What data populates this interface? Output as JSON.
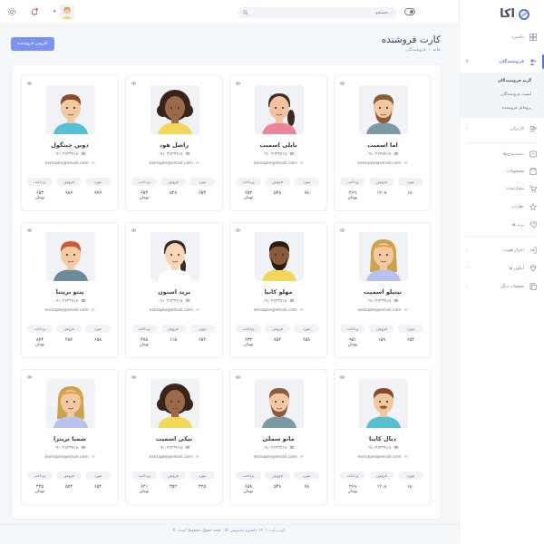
{
  "brand": {
    "name": "اکا",
    "accent": "#6b82e0"
  },
  "search": {
    "placeholder": "جستجو..."
  },
  "topbar": {
    "icons": [
      "toggle-icon",
      "bell-icon",
      "settings-icon"
    ]
  },
  "sidebar": {
    "items": [
      {
        "label": "داشبرد",
        "icon": "grid-icon",
        "arrow": ""
      },
      {
        "label": "فروشندگان",
        "icon": "sellers-icon",
        "arrow": "▾"
      },
      {
        "label": "کاربران",
        "icon": "users-icon",
        "arrow": "‹"
      },
      {
        "label": "دسته‌بندی‌ها",
        "icon": "tag-icon",
        "arrow": ""
      },
      {
        "label": "محصولات",
        "icon": "box-icon",
        "arrow": ""
      },
      {
        "label": "سفارشات",
        "icon": "cart-icon",
        "arrow": ""
      },
      {
        "label": "نظرات",
        "icon": "comment-icon",
        "arrow": ""
      },
      {
        "label": "برند ها",
        "icon": "brand-icon",
        "arrow": ""
      },
      {
        "label": "احراز هویت",
        "icon": "login-icon",
        "arrow": "‹"
      },
      {
        "label": "آیکون ها",
        "icon": "diamond-icon",
        "arrow": "‹"
      },
      {
        "label": "صفحات دیگر",
        "icon": "pages-icon",
        "arrow": "‹"
      }
    ],
    "submenu": [
      "گرید فروشندگان",
      "لیست فروشندگان",
      "پروفایل فروشنده"
    ]
  },
  "page": {
    "title": "کارت فروشنده",
    "breadcrumb_home": "خانه",
    "breadcrumb_sep": "›",
    "breadcrumb_current": "فروشندگان",
    "add_button": "افزودن فروشنده"
  },
  "stat_labels": {
    "items": "مورد",
    "sales": "فروش",
    "payment": "پرداخت",
    "unit": "تومان"
  },
  "sellers": [
    {
      "name": "اما اسمیت",
      "phone": "۰۹۱۰۳۶۳۸۷۱۸",
      "email": "exmaple@email.com",
      "items": "۱۸۰",
      "sales": "۱۲۰۸",
      "payment": "۲۶۹",
      "skin": "#f0c9a0",
      "hair": "#8a5a3a",
      "shirt": "#7c9aa6",
      "beard": true,
      "hairStyle": "short"
    },
    {
      "name": "بایلی اسمیت",
      "phone": "۰۹۱۰۳۶۳۳۷۱۸",
      "email": "exmaple@email.com",
      "items": "۶۵",
      "sales": "۵۴۸",
      "payment": "۶۵۳",
      "skin": "#f2c29e",
      "hair": "#3d2a22",
      "shirt": "#e9879a",
      "beard": false,
      "hairStyle": "pony"
    },
    {
      "name": "راشل هود",
      "phone": "۰۹۱۰۳۶۳۳۷۱۸",
      "email": "exmaple@email.com",
      "items": "۶۵۳",
      "sales": "۵۴۸",
      "payment": "۶۵۳",
      "skin": "#9a6a4a",
      "hair": "#3a241a",
      "shirt": "#f3d75a",
      "beard": false,
      "hairStyle": "curly"
    },
    {
      "name": "دوبن چیتگول",
      "phone": "۰۹۱۰۳۶۳۳۷۱۸",
      "email": "exmaple@email.com",
      "items": "۹۷۷",
      "sales": "۹۸۷",
      "payment": "۶۵۳",
      "skin": "#f0c9a0",
      "hair": "#8a4a2a",
      "shirt": "#56c0d0",
      "beard": false,
      "hairStyle": "short"
    },
    {
      "name": "نیتیلو اسمیت",
      "phone": "۰۹۱۰۳۶۳۳۷۱۸",
      "email": "exmaple@email.com",
      "items": "۶۵۴",
      "sales": "۱۵۹",
      "payment": "۹۵۱",
      "skin": "#f2c9a2",
      "hair": "#caa34a",
      "shirt": "#b8c2f0",
      "beard": false,
      "hairStyle": "long"
    },
    {
      "name": "مهلو کانیا",
      "phone": "۰۹۱۰۳۶۳۳۷۱۸",
      "email": "exmaple@email.com",
      "items": "۶۵۸",
      "sales": "۸۵۴",
      "payment": "۶۳۳",
      "skin": "#8a5a3a",
      "hair": "#2a1a12",
      "shirt": "#f3d75a",
      "beard": true,
      "hairStyle": "short"
    },
    {
      "name": "برید استون",
      "phone": "۰۹۱۰۳۶۳۳۷۱۸",
      "email": "exmaple@email.com",
      "items": "۶۵۲",
      "sales": "۱۱۵",
      "payment": "۴۷۵",
      "skin": "#f6d6b6",
      "hair": "#3a2a22",
      "shirt": "#ffffff",
      "beard": false,
      "hairStyle": "braid"
    },
    {
      "name": "پنتو بریتنا",
      "phone": "۰۹۱۰۳۶۳۳۷۱۸",
      "email": "exmaple@email.com",
      "items": "۶۵۸",
      "sales": "۴۵۷",
      "payment": "۸۷۴",
      "skin": "#f3caa4",
      "hair": "#c85a3a",
      "shirt": "#6c8a9a",
      "beard": false,
      "hairStyle": "short"
    },
    {
      "name": "دیال کاپتا",
      "phone": "۰۹۱۰۳۶۳۳۷۱۸",
      "email": "exmaple@email.com",
      "items": "۱۸۰",
      "sales": "۱۲۰۸",
      "payment": "۲۶۹",
      "skin": "#f0c9a0",
      "hair": "#8a4a2a",
      "shirt": "#56c0d0",
      "beard": false,
      "hairStyle": "short",
      "moustache": true
    },
    {
      "name": "مانو سملی",
      "phone": "۰۹۱۰۳۶۳۳۷۱۸",
      "email": "exmaple@email.com",
      "items": "۶۵",
      "sales": "۵۴۸",
      "payment": "۶۵۸",
      "skin": "#f2c8a4",
      "hair": "#8a5a3a",
      "shirt": "#7c9aa6",
      "beard": true,
      "hairStyle": "short"
    },
    {
      "name": "نیکی اسمیت",
      "phone": "۰۹۱۰۳۶۳۳۷۱۸",
      "email": "exmaple@email.com",
      "items": "۴۲۵",
      "sales": "۳۵۲",
      "payment": "۶۲۱",
      "skin": "#9a6a4a",
      "hair": "#3a241a",
      "shirt": "#f3d75a",
      "beard": false,
      "hairStyle": "curly"
    },
    {
      "name": "شمبا بریتزا",
      "phone": "۰۹۱۰۳۶۳۳۷۱۸",
      "email": "exmaple@email.com",
      "items": "۶۵۴",
      "sales": "۵۷۴",
      "payment": "۴۲۵",
      "skin": "#f2c9a2",
      "hair": "#caa34a",
      "shirt": "#b8c2f0",
      "beard": false,
      "hairStyle": "long"
    }
  ],
  "footer": {
    "prefix": "© کپی رایت ۱۴۰۱",
    "link": "داشبرد مدیریتی اکا",
    "suffix": ". همه حقوق محفوظ است."
  }
}
